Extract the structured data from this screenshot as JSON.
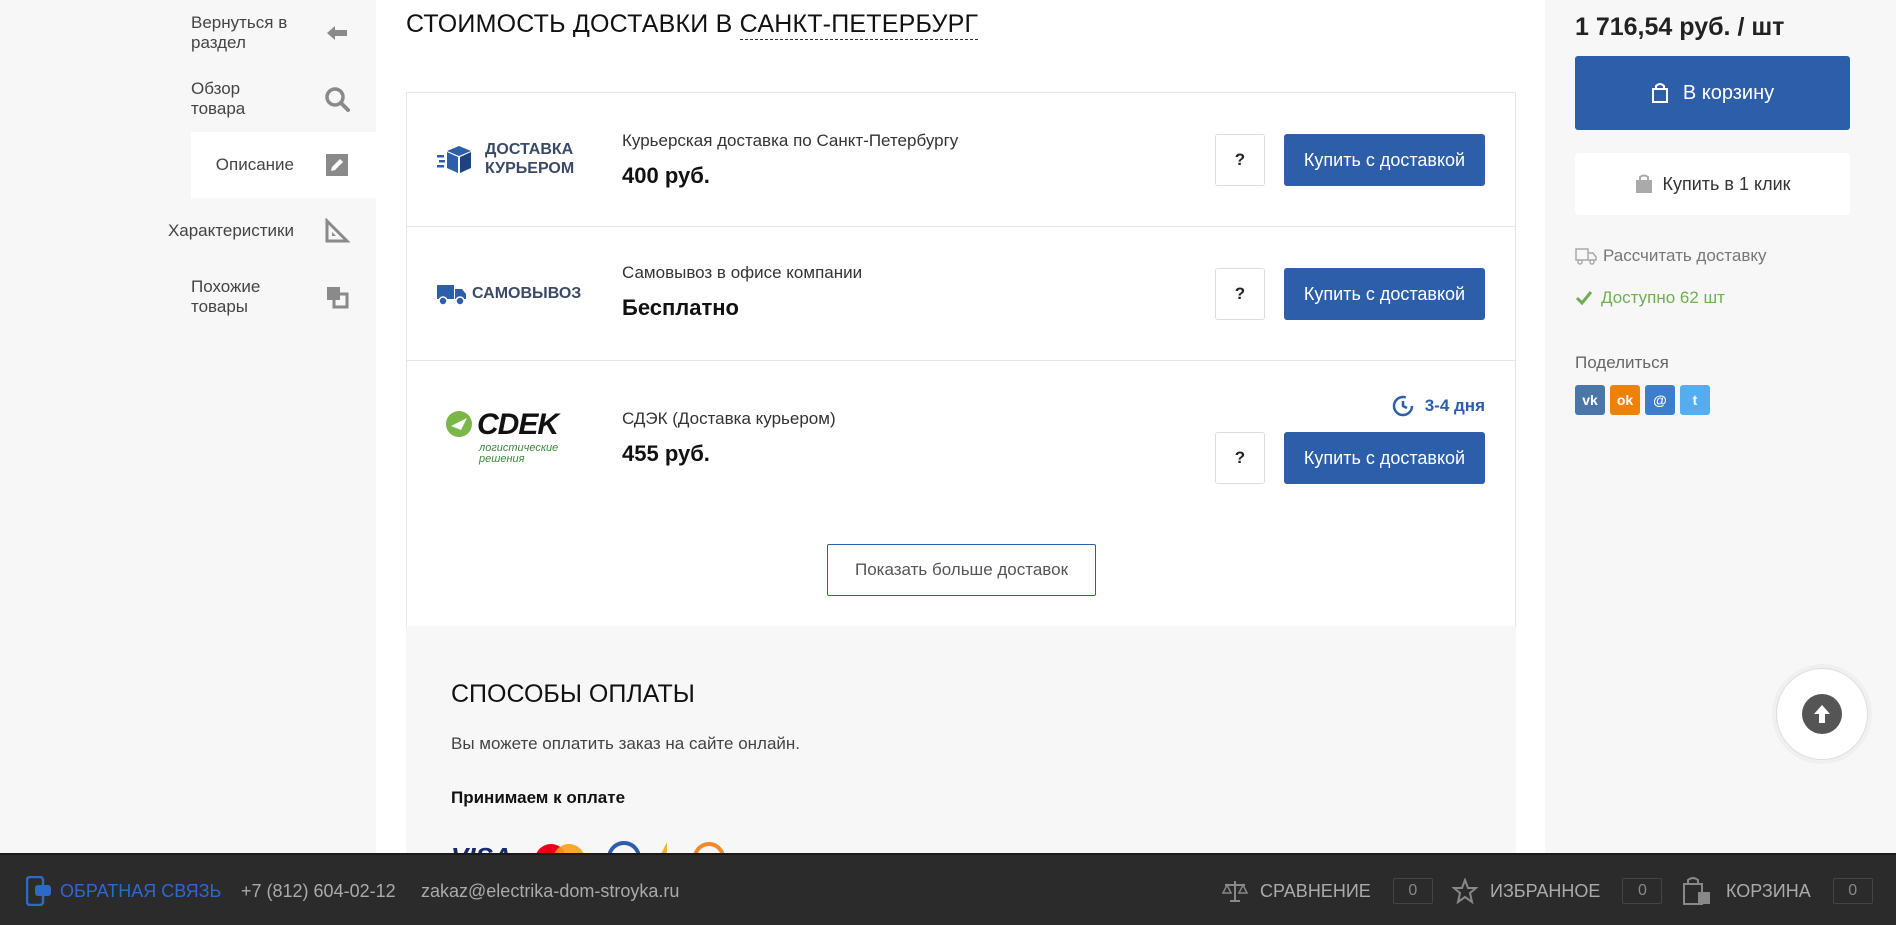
{
  "sidebar": {
    "items": [
      {
        "label": "Вернуться в раздел",
        "icon": "arrow-left-icon"
      },
      {
        "label": "Обзор товара",
        "icon": "search-icon"
      },
      {
        "label": "Описание",
        "icon": "edit-icon"
      },
      {
        "label": "Характеристики",
        "icon": "ruler-icon"
      },
      {
        "label": "Похожие товары",
        "icon": "similar-icon"
      }
    ]
  },
  "delivery": {
    "title_prefix": "СТОИМОСТЬ ДОСТАВКИ В",
    "city": "САНКТ-ПЕТЕРБУРГ",
    "items": [
      {
        "logo_line1": "ДОСТАВКА",
        "logo_line2": "КУРЬЕРОМ",
        "name": "Курьерская доставка по Санкт-Петербургу",
        "price": "400 руб.",
        "help": "?",
        "button": "Купить с доставкой"
      },
      {
        "logo_line1": "САМОВЫВОЗ",
        "name": "Самовывоз в офисе компании",
        "price": "Бесплатно",
        "help": "?",
        "button": "Купить с доставкой"
      },
      {
        "logo_line1": "СDEK",
        "logo_line2": "логистические",
        "logo_line3": "решения",
        "name": "СДЭК (Доставка курьером)",
        "price": "455 руб.",
        "term": "3-4 дня",
        "help": "?",
        "button": "Купить с доставкой"
      }
    ],
    "more_button": "Показать больше доставок"
  },
  "payment": {
    "title": "СПОСОБЫ ОПЛАТЫ",
    "text": "Вы можете оплатить заказ на сайте онлайн.",
    "subtitle": "Принимаем к оплате",
    "visa": "VISA"
  },
  "product": {
    "price": "1 716,54 руб. / шт",
    "cart_button": "В корзину",
    "one_click": "Купить в 1 клик",
    "calc_delivery": "Рассчитать доставку",
    "availability": "Доступно 62 шт",
    "share_label": "Поделиться",
    "share": [
      {
        "name": "vk-icon",
        "color": "#4a76a8",
        "glyph": "vk"
      },
      {
        "name": "ok-icon",
        "color": "#ee8208",
        "glyph": "ok"
      },
      {
        "name": "mailru-icon",
        "color": "#3c7ecb",
        "glyph": "@"
      },
      {
        "name": "twitter-icon",
        "color": "#55acee",
        "glyph": "t"
      }
    ]
  },
  "bottom": {
    "feedback": "ОБРАТНАЯ СВЯЗЬ",
    "phone": "+7 (812) 604-02-12",
    "email": "zakaz@electrika-dom-stroyka.ru",
    "compare": "СРАВНЕНИЕ",
    "compare_count": "0",
    "favorites": "ИЗБРАННОЕ",
    "favorites_count": "0",
    "cart": "КОРЗИНА",
    "cart_count": "0"
  },
  "colors": {
    "accent": "#2d5eaa",
    "available": "#6fae52",
    "bottom_bar": "#2b2b2b"
  }
}
